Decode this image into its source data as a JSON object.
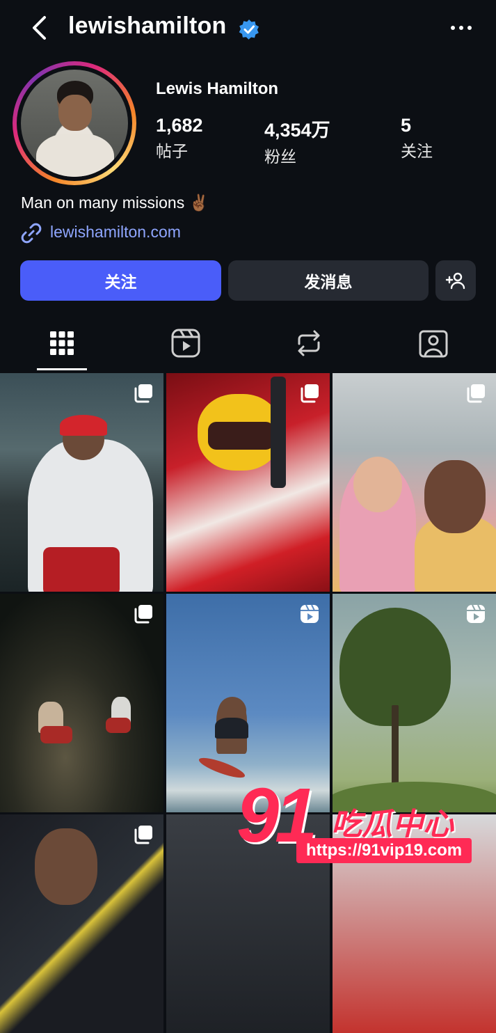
{
  "header": {
    "username": "lewishamilton",
    "back_icon": "chevron-left-icon",
    "verified_icon": "verified-badge-icon",
    "more_icon": "more-horizontal-icon"
  },
  "profile": {
    "display_name": "Lewis Hamilton",
    "stats": [
      {
        "value": "1,682",
        "label": "帖子"
      },
      {
        "value": "4,354万",
        "label": "粉丝"
      },
      {
        "value": "5",
        "label": "关注"
      }
    ],
    "bio": "Man on many missions ✌🏾",
    "link": "lewishamilton.com"
  },
  "actions": {
    "follow": "关注",
    "message": "发消息",
    "add_user_icon": "add-person-icon"
  },
  "tabs": [
    {
      "icon": "grid-icon",
      "active": true
    },
    {
      "icon": "reels-icon",
      "active": false
    },
    {
      "icon": "repost-icon",
      "active": false
    },
    {
      "icon": "tagged-icon",
      "active": false
    }
  ],
  "posts": [
    {
      "type": "carousel"
    },
    {
      "type": "carousel"
    },
    {
      "type": "carousel"
    },
    {
      "type": "carousel"
    },
    {
      "type": "reel"
    },
    {
      "type": "reel"
    },
    {
      "type": "carousel"
    },
    {
      "type": "unknown"
    },
    {
      "type": "unknown"
    }
  ],
  "watermark": {
    "number": "91",
    "name": "吃瓜中心",
    "url": "https://91vip19.com"
  },
  "colors": {
    "background": "#0c0f14",
    "follow_button": "#4a5df9",
    "secondary_button": "#262a32",
    "link": "#8fa6ff",
    "verified": "#3897f0",
    "watermark": "#ff2a55"
  }
}
